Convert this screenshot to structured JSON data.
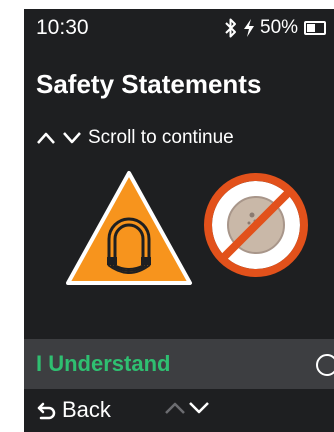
{
  "status_bar": {
    "time": "10:30",
    "battery_percent": "50%",
    "battery_level": 0.5,
    "icons": [
      "bluetooth-icon",
      "charging-bolt-icon",
      "battery-icon"
    ]
  },
  "screen": {
    "title": "Safety Statements",
    "scroll_hint": "Scroll to continue",
    "icons": [
      "magnet-warning-icon",
      "no-sensor-icon"
    ]
  },
  "action": {
    "understand_label": "I Understand",
    "checked": false
  },
  "nav": {
    "back_label": "Back"
  },
  "colors": {
    "background": "#1e1f21",
    "action_bar": "#3d3e41",
    "accent_green": "#2fbf71",
    "warning_orange": "#f7941d",
    "prohibit_red": "#e2511b"
  }
}
